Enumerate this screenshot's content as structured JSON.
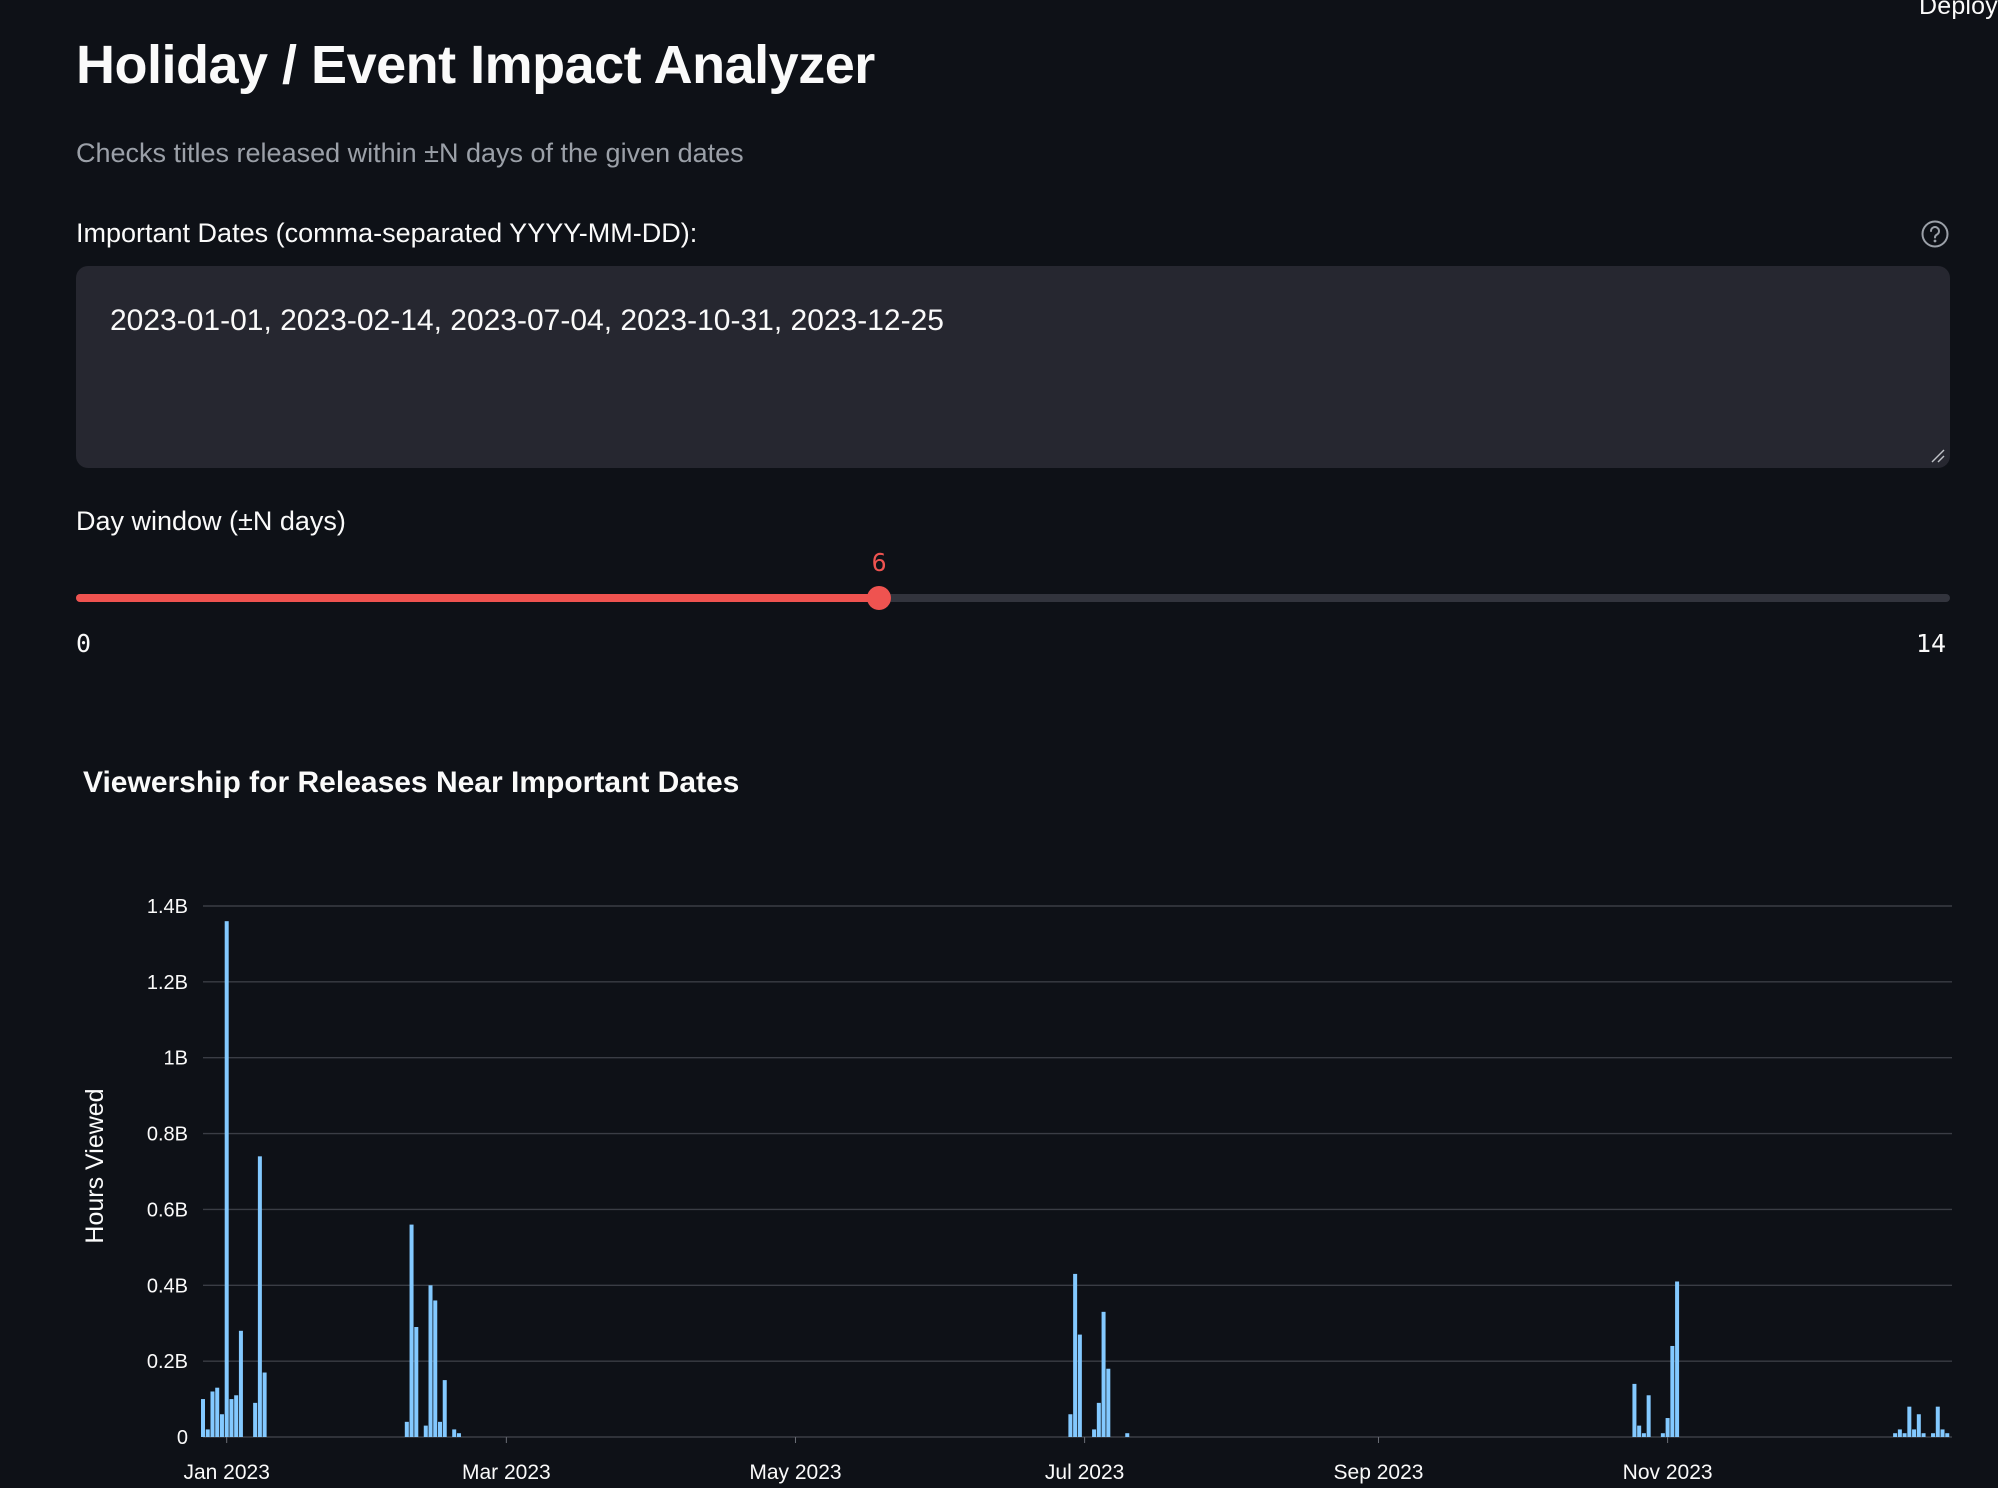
{
  "header": {
    "deploy_label": "Deploy"
  },
  "page": {
    "title": "Holiday / Event Impact Analyzer",
    "subtitle": "Checks titles released within ±N days of the given dates"
  },
  "dates_input": {
    "label": "Important Dates (comma-separated YYYY-MM-DD):",
    "value": "2023-01-01, 2023-02-14, 2023-07-04, 2023-10-31, 2023-12-25",
    "help_icon": "question-circle-icon"
  },
  "day_window": {
    "label": "Day window (±N days)",
    "value": 6,
    "value_text": "6",
    "min": 0,
    "max": 14,
    "min_text": "0",
    "max_text": "14"
  },
  "colors": {
    "accent": "#ef5350",
    "bar": "#83c9ff",
    "grid": "#3a3d45"
  },
  "chart_data": {
    "type": "bar",
    "title": "Viewership for Releases Near Important Dates",
    "xlabel": "",
    "ylabel": "Hours Viewed",
    "y_ticks": [
      {
        "value": 0,
        "label": "0"
      },
      {
        "value": 0.2,
        "label": "0.2B"
      },
      {
        "value": 0.4,
        "label": "0.4B"
      },
      {
        "value": 0.6,
        "label": "0.6B"
      },
      {
        "value": 0.8,
        "label": "0.8B"
      },
      {
        "value": 1.0,
        "label": "1B"
      },
      {
        "value": 1.2,
        "label": "1.2B"
      },
      {
        "value": 1.4,
        "label": "1.4B"
      }
    ],
    "ylim": [
      0,
      1.4
    ],
    "x_domain": [
      "2022-12-27",
      "2023-12-31"
    ],
    "x_ticks": [
      {
        "date": "2023-01-01",
        "label": "Jan 2023"
      },
      {
        "date": "2023-03-01",
        "label": "Mar 2023"
      },
      {
        "date": "2023-05-01",
        "label": "May 2023"
      },
      {
        "date": "2023-07-01",
        "label": "Jul 2023"
      },
      {
        "date": "2023-09-01",
        "label": "Sep 2023"
      },
      {
        "date": "2023-11-01",
        "label": "Nov 2023"
      }
    ],
    "grid": true,
    "y_unit": "billions of hours",
    "bars": [
      {
        "date": "2022-12-27",
        "value": 0.1
      },
      {
        "date": "2022-12-28",
        "value": 0.02
      },
      {
        "date": "2022-12-29",
        "value": 0.12
      },
      {
        "date": "2022-12-30",
        "value": 0.13
      },
      {
        "date": "2022-12-31",
        "value": 0.06
      },
      {
        "date": "2023-01-01",
        "value": 1.36
      },
      {
        "date": "2023-01-02",
        "value": 0.1
      },
      {
        "date": "2023-01-03",
        "value": 0.11
      },
      {
        "date": "2023-01-04",
        "value": 0.28
      },
      {
        "date": "2023-01-07",
        "value": 0.09
      },
      {
        "date": "2023-01-08",
        "value": 0.74
      },
      {
        "date": "2023-01-09",
        "value": 0.17
      },
      {
        "date": "2023-02-08",
        "value": 0.04
      },
      {
        "date": "2023-02-09",
        "value": 0.56
      },
      {
        "date": "2023-02-10",
        "value": 0.29
      },
      {
        "date": "2023-02-12",
        "value": 0.03
      },
      {
        "date": "2023-02-13",
        "value": 0.4
      },
      {
        "date": "2023-02-14",
        "value": 0.36
      },
      {
        "date": "2023-02-15",
        "value": 0.04
      },
      {
        "date": "2023-02-16",
        "value": 0.15
      },
      {
        "date": "2023-02-18",
        "value": 0.02
      },
      {
        "date": "2023-02-19",
        "value": 0.01
      },
      {
        "date": "2023-06-28",
        "value": 0.06
      },
      {
        "date": "2023-06-29",
        "value": 0.43
      },
      {
        "date": "2023-06-30",
        "value": 0.27
      },
      {
        "date": "2023-07-03",
        "value": 0.02
      },
      {
        "date": "2023-07-04",
        "value": 0.09
      },
      {
        "date": "2023-07-05",
        "value": 0.33
      },
      {
        "date": "2023-07-06",
        "value": 0.18
      },
      {
        "date": "2023-07-10",
        "value": 0.01
      },
      {
        "date": "2023-10-25",
        "value": 0.14
      },
      {
        "date": "2023-10-26",
        "value": 0.03
      },
      {
        "date": "2023-10-27",
        "value": 0.01
      },
      {
        "date": "2023-10-28",
        "value": 0.11
      },
      {
        "date": "2023-10-31",
        "value": 0.01
      },
      {
        "date": "2023-11-01",
        "value": 0.05
      },
      {
        "date": "2023-11-02",
        "value": 0.24
      },
      {
        "date": "2023-11-03",
        "value": 0.41
      },
      {
        "date": "2023-12-19",
        "value": 0.01
      },
      {
        "date": "2023-12-20",
        "value": 0.02
      },
      {
        "date": "2023-12-21",
        "value": 0.01
      },
      {
        "date": "2023-12-22",
        "value": 0.08
      },
      {
        "date": "2023-12-23",
        "value": 0.02
      },
      {
        "date": "2023-12-24",
        "value": 0.06
      },
      {
        "date": "2023-12-25",
        "value": 0.01
      },
      {
        "date": "2023-12-27",
        "value": 0.01
      },
      {
        "date": "2023-12-28",
        "value": 0.08
      },
      {
        "date": "2023-12-29",
        "value": 0.02
      },
      {
        "date": "2023-12-30",
        "value": 0.01
      }
    ]
  }
}
